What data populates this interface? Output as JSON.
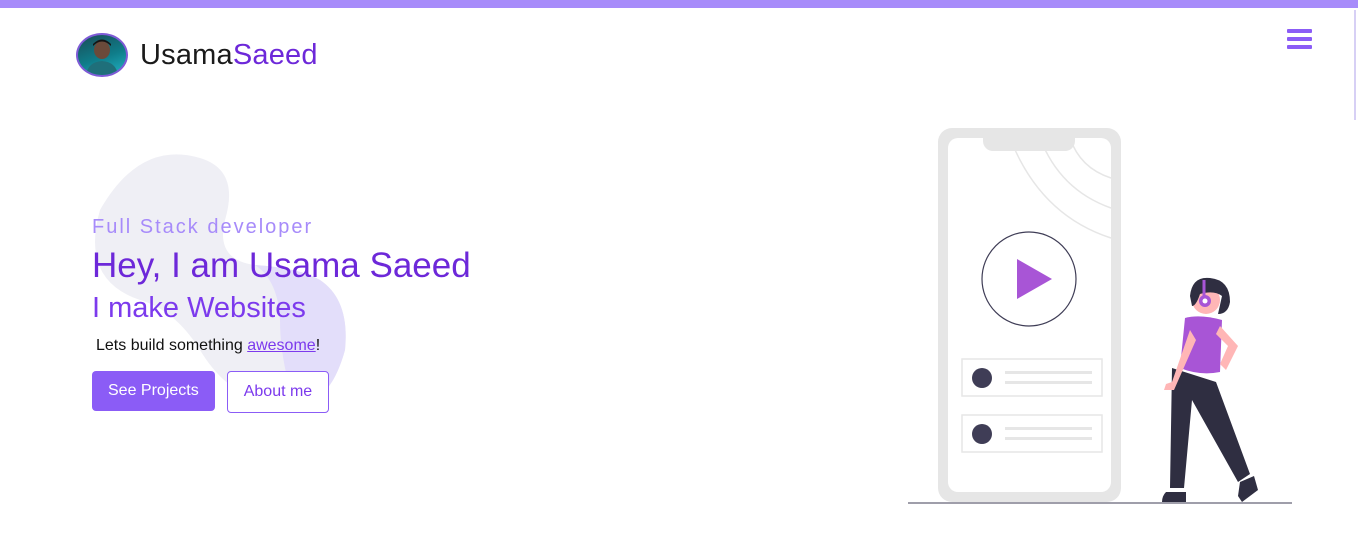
{
  "header": {
    "brand_first": "Usama",
    "brand_second": "Saeed",
    "avatar_alt": "profile photo"
  },
  "hero": {
    "subtitle": "Full Stack developer",
    "headline": "Hey, I am Usama Saeed",
    "tagline": "I make Websites",
    "intro_text": "Lets build something ",
    "intro_link": "awesome",
    "intro_end": "!",
    "primary_button": "See Projects",
    "secondary_button": "About me"
  },
  "colors": {
    "accent": "#8b5cf6",
    "accent_dark": "#6d28d9",
    "accent_light": "#a78bfa",
    "figure_shirt": "#a855d6",
    "figure_pants": "#2f2e41"
  },
  "icons": {
    "menu": "hamburger-menu-icon",
    "play": "play-icon"
  }
}
